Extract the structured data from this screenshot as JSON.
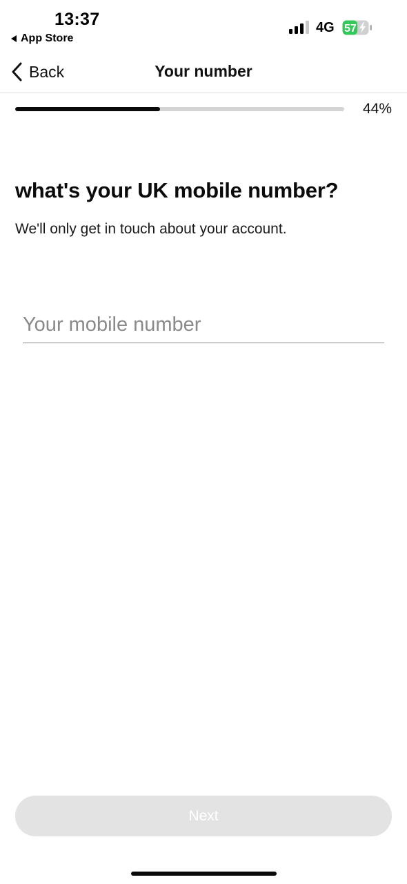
{
  "status_bar": {
    "time": "13:37",
    "back_app": "App Store",
    "network": "4G",
    "battery_level": "57",
    "battery_percent": 57,
    "battery_color": "#34c759",
    "battery_charging": true
  },
  "nav": {
    "back_label": "Back",
    "title": "Your number"
  },
  "progress": {
    "value_percent": 44,
    "label": "44%"
  },
  "content": {
    "heading": "what's your UK mobile number?",
    "subheading": "We'll only get in touch about your account."
  },
  "form": {
    "mobile_placeholder": "Your mobile number",
    "mobile_value": ""
  },
  "footer": {
    "next_label": "Next",
    "next_enabled": false
  },
  "colors": {
    "progress_fill": "#0a0a0a",
    "progress_track": "#d4d4d4",
    "button_disabled_bg": "#e3e3e3"
  }
}
